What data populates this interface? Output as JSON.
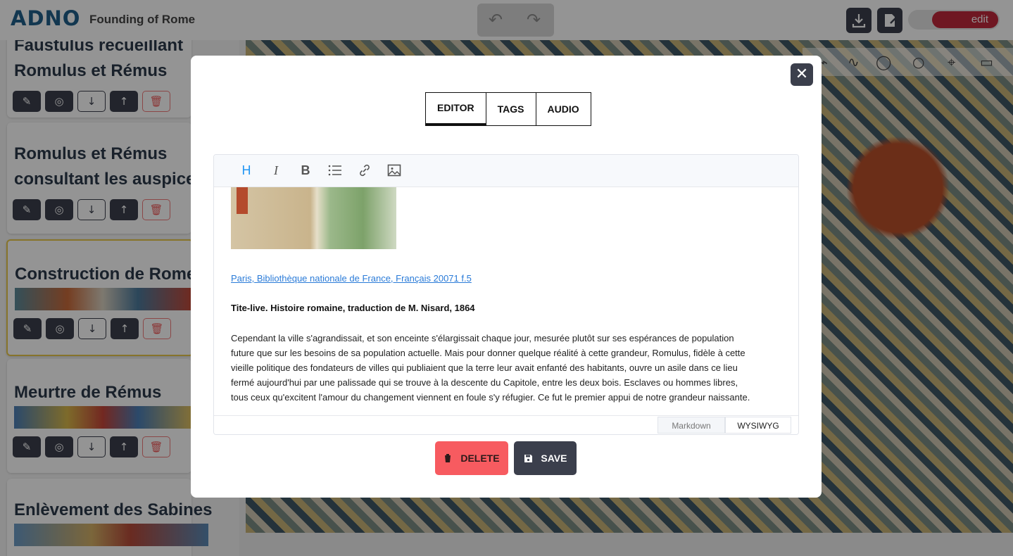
{
  "app": {
    "logo": "ADNO",
    "project_title": "Founding of Rome",
    "edit_toggle_label": "edit"
  },
  "header": {
    "undo_icon": "undo-icon",
    "redo_icon": "redo-icon",
    "download_icon": "download-icon",
    "export_icon": "export-icon"
  },
  "sidebar": {
    "cards": [
      {
        "title_line1": "Faustulus recueillant",
        "title_line2": "Romulus et Rémus"
      },
      {
        "title_line1": "Romulus et Rémus",
        "title_line2": "consultant les auspices"
      },
      {
        "title_line1": "Construction de Rome"
      },
      {
        "title_line1": "Meurtre de Rémus"
      },
      {
        "title_line1": "Enlèvement des Sabines"
      }
    ]
  },
  "modal": {
    "tabs": [
      "EDITOR",
      "TAGS",
      "AUDIO"
    ],
    "toolbar": {
      "heading": "H",
      "italic": "I",
      "bold": "B"
    },
    "content": {
      "link": "Paris, Bibliothèque nationale de France, Français 20071 f.5",
      "bold_line": "Tite-live. Histoire romaine, traduction de M. Nisard, 1864",
      "paragraph_lines": [
        "Cependant la ville s'agrandissait, et son enceinte s'élargissait chaque jour, mesurée plutôt sur ses espérances de population",
        "future que sur les besoins de sa population actuelle. Mais pour donner quelque réalité à cette grandeur, Romulus, fidèle à cette",
        "vieille politique des fondateurs de villes qui publiaient que la terre leur avait enfanté des habitants, ouvre un asile dans ce lieu",
        "fermé aujourd'hui par une palissade qui se trouve à la descente du Capitole, entre les deux bois. Esclaves ou hommes libres,",
        "tous ceux qu'excitent l'amour du changement viennent en foule s'y réfugier. Ce fut le premier appui de notre grandeur naissante."
      ]
    },
    "modes": {
      "markdown": "Markdown",
      "wysiwyg": "WYSIWYG"
    },
    "buttons": {
      "delete": "DELETE",
      "save": "SAVE"
    }
  }
}
